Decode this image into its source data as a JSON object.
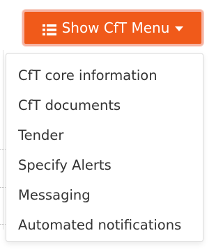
{
  "toggle": {
    "label": "Show CfT Menu",
    "icon": "list-icon",
    "caret": "caret-down-icon",
    "background_color": "#f05a1a",
    "border_color": "#f6b3a3"
  },
  "menu": {
    "items": [
      {
        "label": "CfT core information"
      },
      {
        "label": "CfT documents"
      },
      {
        "label": "Tender"
      },
      {
        "label": "Specify Alerts"
      },
      {
        "label": "Messaging"
      },
      {
        "label": "Automated notifications"
      }
    ]
  }
}
